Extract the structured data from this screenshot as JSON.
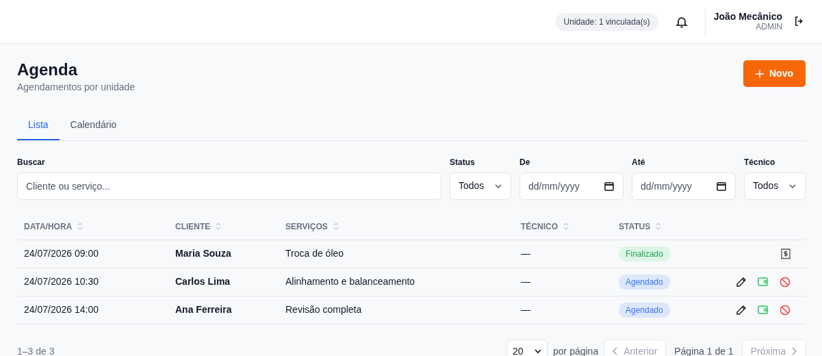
{
  "header": {
    "unit_badge": "Unidade: 1 vinculada(s)",
    "user_name": "João Mecânico",
    "user_role": "ADMIN"
  },
  "page": {
    "title": "Agenda",
    "subtitle": "Agendamentos por unidade",
    "new_button": "Novo"
  },
  "tabs": [
    {
      "label": "Lista",
      "selected": true
    },
    {
      "label": "Calendário",
      "selected": false
    }
  ],
  "filters": [
    {
      "kind": "text",
      "label": "Buscar",
      "placeholder": "Cliente ou serviço..."
    },
    {
      "kind": "select",
      "label": "Status",
      "value": "Todos"
    },
    {
      "kind": "date",
      "label": "De",
      "placeholder": "dd/mm/yyyy"
    },
    {
      "kind": "date",
      "label": "Até",
      "placeholder": "dd/mm/yyyy"
    },
    {
      "kind": "select",
      "label": "Técnico",
      "value": "Todos"
    }
  ],
  "table": {
    "columns": [
      "DATA/HORA",
      "CLIENTE",
      "SERVIÇOS",
      "TÉCNICO",
      "STATUS"
    ],
    "rows": [
      {
        "datetime": "24/07/2026 09:00",
        "client": "Maria Souza",
        "services": "Troca de óleo",
        "technician": "—",
        "status": {
          "label": "Finalizado",
          "kind": "done"
        },
        "actions": [
          {
            "kind": "receipt"
          }
        ]
      },
      {
        "datetime": "24/07/2026 10:30",
        "client": "Carlos Lima",
        "services": "Alinhamento e balanceamento",
        "technician": "—",
        "status": {
          "label": "Agendado",
          "kind": "scheduled"
        },
        "actions": [
          {
            "kind": "edit"
          },
          {
            "kind": "payment"
          },
          {
            "kind": "cancel"
          }
        ]
      },
      {
        "datetime": "24/07/2026 14:00",
        "client": "Ana Ferreira",
        "services": "Revisão completa",
        "technician": "—",
        "status": {
          "label": "Agendado",
          "kind": "scheduled"
        },
        "actions": [
          {
            "kind": "edit"
          },
          {
            "kind": "payment"
          },
          {
            "kind": "cancel"
          }
        ]
      }
    ]
  },
  "footer": {
    "range": "1–3 de 3",
    "page_size": "20",
    "page_size_label": "por página",
    "prev": "Anterior",
    "page_info": "Página 1 de 1",
    "next": "Próxima"
  }
}
